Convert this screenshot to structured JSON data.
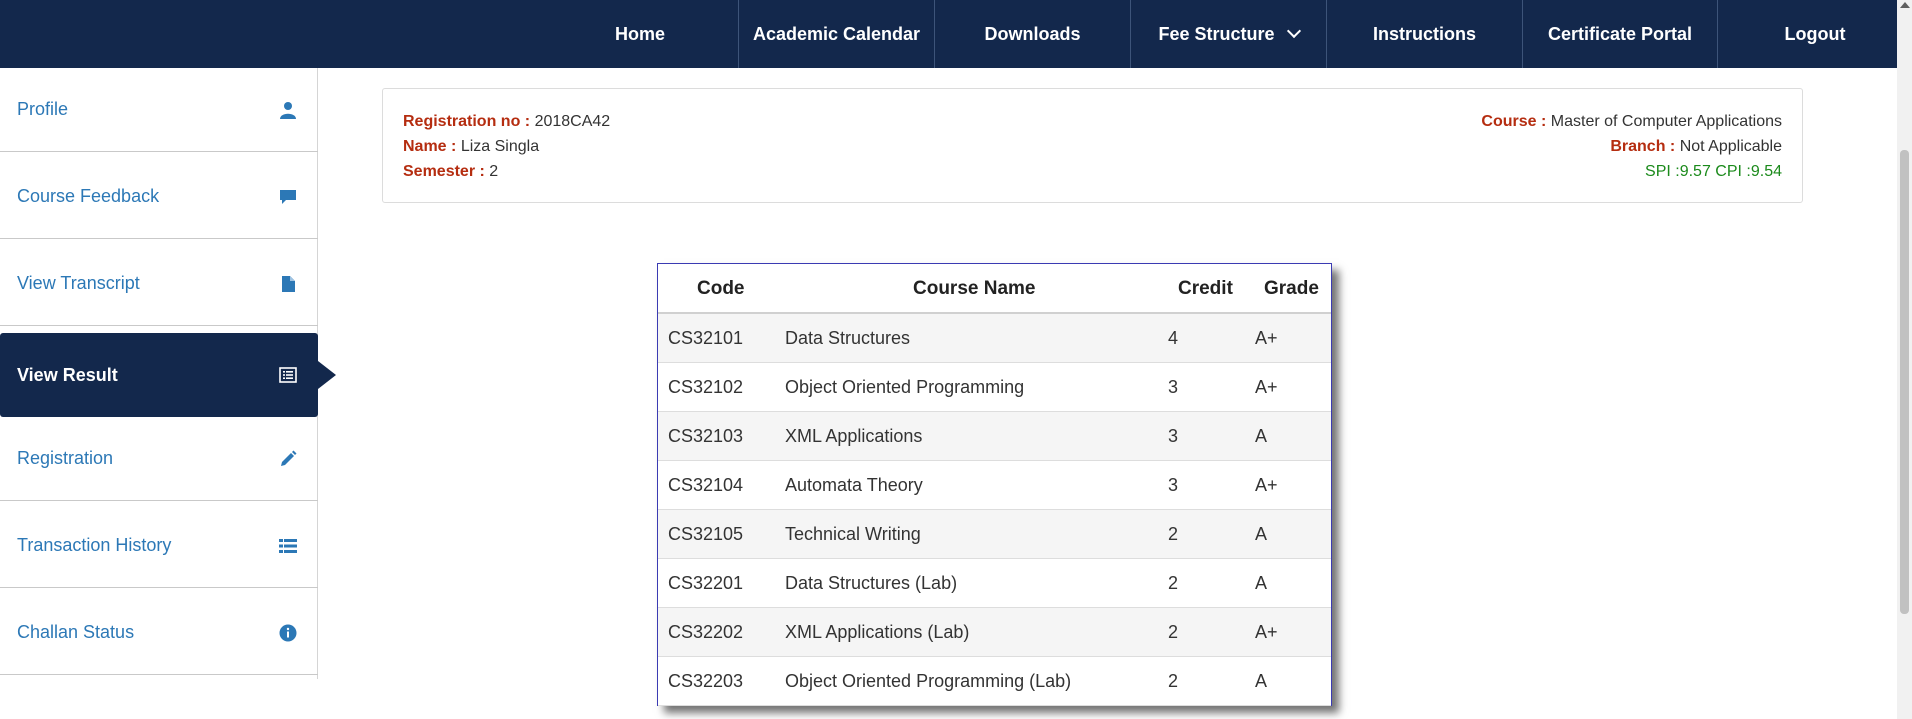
{
  "nav": {
    "items": [
      {
        "label": "Home"
      },
      {
        "label": "Academic Calendar"
      },
      {
        "label": "Downloads"
      },
      {
        "label": "Fee Structure"
      },
      {
        "label": "Instructions"
      },
      {
        "label": "Certificate Portal"
      },
      {
        "label": "Logout"
      }
    ],
    "dropdown_icon": "chevron-down-icon"
  },
  "sidebar": {
    "items": [
      {
        "label": "Profile",
        "icon": "user-icon"
      },
      {
        "label": "Course Feedback",
        "icon": "comment-icon"
      },
      {
        "label": "View Transcript",
        "icon": "file-icon"
      },
      {
        "label": "View Result",
        "icon": "list-alt-icon",
        "active": true
      },
      {
        "label": "Registration",
        "icon": "pencil-icon"
      },
      {
        "label": "Transaction History",
        "icon": "list-icon"
      },
      {
        "label": "Challan Status",
        "icon": "info-icon"
      }
    ]
  },
  "student": {
    "reg_label": "Registration no :",
    "reg_value": "2018CA42",
    "name_label": "Name :",
    "name_value": "Liza Singla",
    "semester_label": "Semester :",
    "semester_value": "2",
    "course_label": "Course :",
    "course_value": "Master of Computer Applications",
    "branch_label": "Branch :",
    "branch_value": "Not Applicable",
    "spi_cpi": "SPI :9.57 CPI :9.54"
  },
  "result": {
    "headers": {
      "code": "Code",
      "name": "Course Name",
      "credit": "Credit",
      "grade": "Grade"
    },
    "rows": [
      {
        "code": "CS32101",
        "name": "Data Structures",
        "credit": "4",
        "grade": "A+"
      },
      {
        "code": "CS32102",
        "name": "Object Oriented Programming",
        "credit": "3",
        "grade": "A+"
      },
      {
        "code": "CS32103",
        "name": "XML Applications",
        "credit": "3",
        "grade": "A"
      },
      {
        "code": "CS32104",
        "name": "Automata Theory",
        "credit": "3",
        "grade": "A+"
      },
      {
        "code": "CS32105",
        "name": "Technical Writing",
        "credit": "2",
        "grade": "A"
      },
      {
        "code": "CS32201",
        "name": "Data Structures (Lab)",
        "credit": "2",
        "grade": "A"
      },
      {
        "code": "CS32202",
        "name": "XML Applications (Lab)",
        "credit": "2",
        "grade": "A+"
      },
      {
        "code": "CS32203",
        "name": "Object Oriented Programming (Lab)",
        "credit": "2",
        "grade": "A"
      }
    ]
  },
  "colors": {
    "navbar": "#13284c",
    "link": "#2c78b6",
    "label": "#b52d10",
    "spi": "#1b8a1b",
    "table_border": "#3b3bb3"
  }
}
